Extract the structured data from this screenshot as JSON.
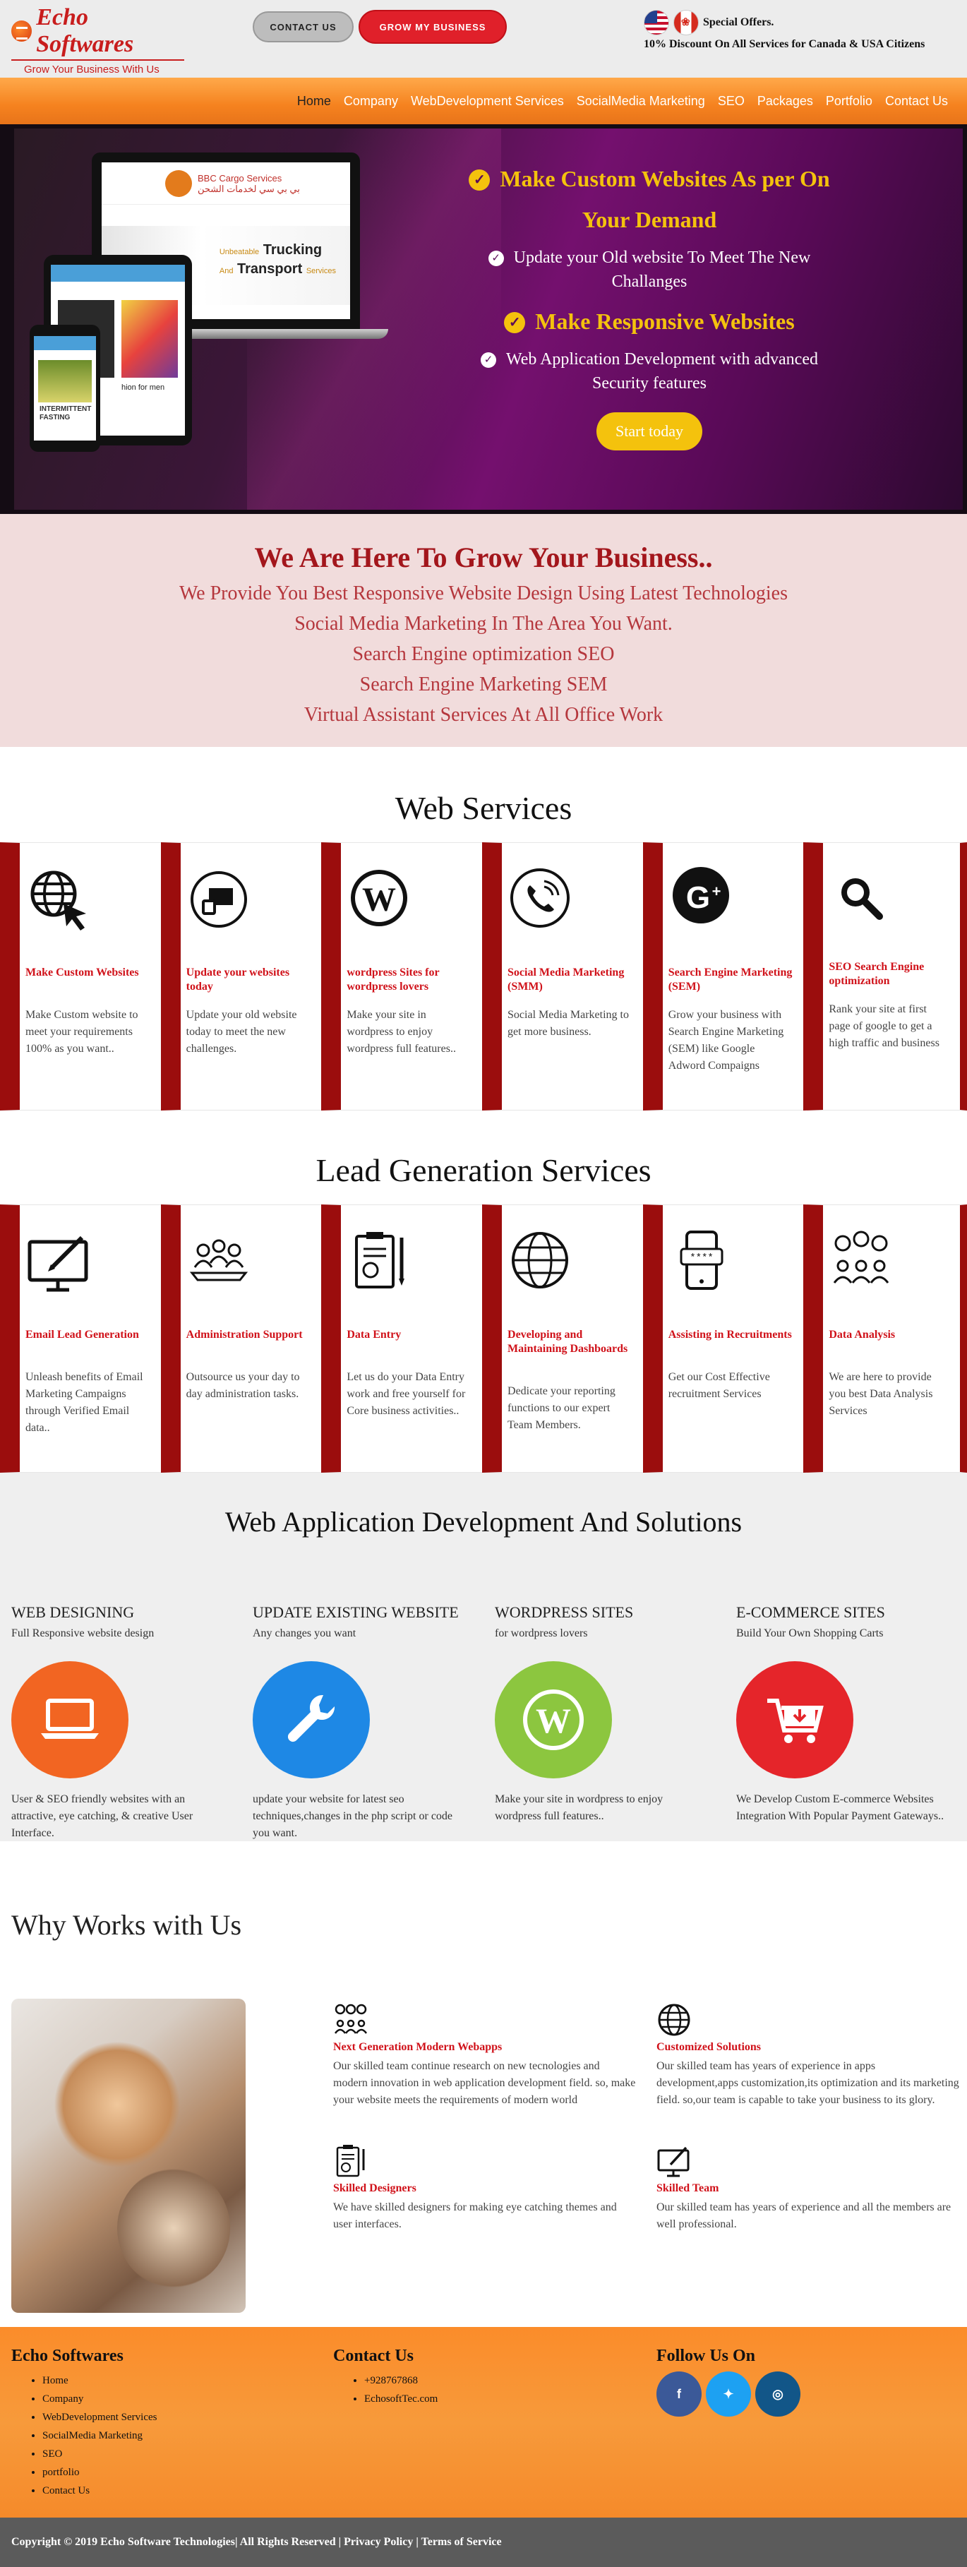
{
  "brand": {
    "name": "Echo Softwares",
    "tagline": "Grow Your Business With Us"
  },
  "top": {
    "contact_label": "CONTACT US",
    "grow_label": "GROW MY BUSINESS",
    "offer_title": "Special Offers.",
    "offer_text": "10% Discount On All Services for Canada & USA Citizens"
  },
  "nav": [
    "Home",
    "Company",
    "WebDevelopment Services",
    "SocialMedia Marketing",
    "SEO",
    "Packages",
    "Portfolio",
    "Contact Us"
  ],
  "hero": {
    "heading1": "Make Custom Websites As per On Your Demand",
    "point1": "Update your Old website To Meet The New Challanges",
    "heading2": "Make Responsive Websites",
    "point2": "Web Application Development with advanced Security features",
    "cta": "Start today",
    "mock_brand": "BBC Cargo Services",
    "mock_arabic": "بي بي سي لخدمات الشحن",
    "mock_tag": "Unbeatable",
    "mock_trucking": "Trucking",
    "mock_and": "And",
    "mock_transport": "Transport",
    "mock_services": "Services",
    "mock_phone_text": "INTERMITTENT FASTING",
    "mock_tablet_text": "hion for men"
  },
  "intro": {
    "title": "We Are Here To Grow Your Business..",
    "lines": [
      "We Provide You Best Responsive Website Design Using Latest Technologies",
      "Social Media Marketing In The Area You Want.",
      "Search Engine optimization SEO",
      "Search Engine Marketing SEM",
      "Virtual Assistant Services At All Office Work"
    ]
  },
  "web_services": {
    "title": "Web Services",
    "cards": [
      {
        "icon": "globe-cursor-icon",
        "title": "Make Custom Websites",
        "desc": "Make Custom website to meet your requirements 100% as you want.."
      },
      {
        "icon": "update-screen-icon",
        "title": "Update your websites today",
        "desc": "Update your old website today to meet the new challenges."
      },
      {
        "icon": "wordpress-icon",
        "title": "wordpress Sites for wordpress lovers",
        "desc": "Make your site in wordpress to enjoy wordpress full features.."
      },
      {
        "icon": "phone-call-icon",
        "title": "Social Media Marketing (SMM)",
        "desc": "Social Media Marketing to get more business."
      },
      {
        "icon": "google-icon",
        "title": "Search Engine Marketing (SEM)",
        "desc": "Grow your business with Search Engine Marketing (SEM) like Google Adword Compaigns"
      },
      {
        "icon": "search-icon",
        "title": "SEO Search Engine optimization",
        "desc": "Rank your site at first page of google to get a high traffic and business"
      }
    ]
  },
  "lead_gen": {
    "title": "Lead Generation Services",
    "cards": [
      {
        "icon": "monitor-pen-icon",
        "title": "Email Lead Generation",
        "desc": "Unleash benefits of Email Marketing Campaigns through Verified Email data.."
      },
      {
        "icon": "team-support-icon",
        "title": "Administration Support",
        "desc": "Outsource us your day to day administration tasks."
      },
      {
        "icon": "clipboard-chart-icon",
        "title": "Data Entry",
        "desc": "Let us do your Data Entry work and free yourself for Core business activities.."
      },
      {
        "icon": "globe-icon",
        "title": "Developing and Maintaining Dashboards",
        "desc": "Dedicate your reporting functions to our expert Team Members."
      },
      {
        "icon": "mobile-password-icon",
        "title": "Assisting in Recruitments",
        "desc": "Get our Cost Effective recruitment Services"
      },
      {
        "icon": "people-idea-icon",
        "title": "Data Analysis",
        "desc": "We are here to provide you best Data Analysis Services"
      }
    ]
  },
  "web_app": {
    "title": "Web Application Development And Solutions",
    "items": [
      {
        "heading": "WEB DESIGNING",
        "sub": "Full Responsive website design",
        "icon": "laptop-icon",
        "color": "#f26522",
        "desc": "User & SEO friendly websites with an attractive, eye catching, & creative User Interface."
      },
      {
        "heading": "UPDATE EXISTING WEBSITE",
        "sub": "Any changes you want",
        "icon": "wrench-icon",
        "color": "#1e88e5",
        "desc": "update your website for latest seo techniques,changes in the php script or code you want."
      },
      {
        "heading": "WORDPRESS SITES",
        "sub": "for wordpress lovers",
        "icon": "wordpress-icon",
        "color": "#8cc63f",
        "desc": "Make your site in wordpress to enjoy wordpress full features.."
      },
      {
        "heading": "E-COMMERCE SITES",
        "sub": "Build Your Own Shopping Carts",
        "icon": "cart-icon",
        "color": "#e5252a",
        "desc": "We Develop Custom E-commerce Websites Integration With Popular Payment Gateways.."
      }
    ]
  },
  "why": {
    "title": "Why Works with Us",
    "items": [
      {
        "icon": "network-people-icon",
        "title": "Next Generation Modern Webapps",
        "desc": "Our skilled team continue research on new tecnologies and modern innovation in web application development field. so, make your website meets the requirements of modern world"
      },
      {
        "icon": "globe-icon",
        "title": "Customized Solutions",
        "desc": "Our skilled team has years of experience in apps development,apps customization,its optimization and its marketing field. so,our team is capable to take your business to its glory."
      },
      {
        "icon": "clipboard-chart-icon",
        "title": "Skilled Designers",
        "desc": "We have skilled designers for making eye catching themes and user interfaces."
      },
      {
        "icon": "monitor-pen-icon",
        "title": "Skilled Team",
        "desc": "Our skilled team has years of experience and all the members are well professional."
      }
    ]
  },
  "footer": {
    "col1_title": "Echo Softwares",
    "col1_links": [
      "Home",
      "Company",
      "WebDevelopment Services",
      "SocialMedia Marketing",
      "SEO",
      "portfolio",
      "Contact Us"
    ],
    "col2_title": "Contact Us",
    "col2_items": [
      "+928767868",
      "EchosoftTec.com"
    ],
    "col3_title": "Follow Us On",
    "social": [
      {
        "icon": "facebook-icon",
        "glyph": "f",
        "color": "#3b5998"
      },
      {
        "icon": "twitter-icon",
        "glyph": "✦",
        "color": "#1da1f2"
      },
      {
        "icon": "instagram-icon",
        "glyph": "◎",
        "color": "#125688"
      }
    ],
    "copyright": "Copyright © 2019 Echo Software Technologies| All Rights Reserved | Privacy Policy | Terms of Service"
  }
}
